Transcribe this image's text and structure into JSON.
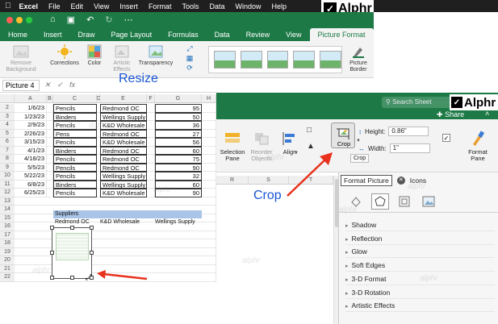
{
  "menubar": {
    "apple_icon": "apple-logo",
    "items": [
      "Excel",
      "File",
      "Edit",
      "View",
      "Insert",
      "Format",
      "Tools",
      "Data",
      "Window",
      "Help"
    ]
  },
  "branding": {
    "logo_text": "Alphr",
    "watermark": "alphr"
  },
  "ribbon_tabs": [
    "Home",
    "Insert",
    "Draw",
    "Page Layout",
    "Formulas",
    "Data",
    "Review",
    "View",
    "Picture Format"
  ],
  "active_tab": "Picture Format",
  "ribbon_left": {
    "remove_background": "Remove Background",
    "corrections": "Corrections",
    "color": "Color",
    "artistic_effects": "Artistic Effects",
    "transparency": "Transparency",
    "picture_border": "Picture Border"
  },
  "formula_bar": {
    "name_box": "Picture 4",
    "fx_symbol": "fx"
  },
  "annotations": {
    "resize": "Resize",
    "crop": "Crop"
  },
  "left_sheet": {
    "columns": [
      "A",
      "B",
      "C",
      "D",
      "E",
      "F",
      "G",
      "H"
    ],
    "rows": [
      {
        "num": "2",
        "date": "1/6/23",
        "item": "Pencils",
        "supplier": "Redmond OC",
        "qty": "95"
      },
      {
        "num": "3",
        "date": "1/23/23",
        "item": "Binders",
        "supplier": "Wellings Supply",
        "qty": "50"
      },
      {
        "num": "4",
        "date": "2/9/23",
        "item": "Pencils",
        "supplier": "K&D Wholesale",
        "qty": "36"
      },
      {
        "num": "5",
        "date": "2/26/23",
        "item": "Pens",
        "supplier": "Redmond OC",
        "qty": "27"
      },
      {
        "num": "6",
        "date": "3/15/23",
        "item": "Pencils",
        "supplier": "K&D Wholesale",
        "qty": "56"
      },
      {
        "num": "7",
        "date": "4/1/23",
        "item": "Binders",
        "supplier": "Redmond OC",
        "qty": "60"
      },
      {
        "num": "8",
        "date": "4/18/23",
        "item": "Pencils",
        "supplier": "Redmond OC",
        "qty": "75"
      },
      {
        "num": "9",
        "date": "5/5/23",
        "item": "Pencils",
        "supplier": "Redmond OC",
        "qty": "90"
      },
      {
        "num": "10",
        "date": "5/22/23",
        "item": "Pencils",
        "supplier": "Wellings Supply",
        "qty": "32"
      },
      {
        "num": "11",
        "date": "6/8/23",
        "item": "Binders",
        "supplier": "Wellings Supply",
        "qty": "60"
      },
      {
        "num": "12",
        "date": "6/25/23",
        "item": "Pencils",
        "supplier": "K&D Wholesale",
        "qty": "90"
      }
    ],
    "extra_rows": [
      "13",
      "14",
      "15",
      "16",
      "17",
      "18",
      "19",
      "20",
      "21",
      "22"
    ],
    "suppliers_header": "Suppliers",
    "suppliers": [
      "Redmond OC",
      "K&D Wholesale",
      "Wellings Supply"
    ]
  },
  "right_panel": {
    "search_placeholder": "Search Sheet",
    "share_label": "Share",
    "ribbon": {
      "selection_pane": "Selection Pane",
      "reorder_objects": "Reorder Objects",
      "align": "Align",
      "crop": "Crop",
      "height_label": "Height:",
      "height_value": "0.86\"",
      "width_label": "Width:",
      "width_value": "1\"",
      "format_pane": "Format Pane",
      "tooltip": "Crop"
    },
    "columns": [
      "R",
      "S",
      "T"
    ],
    "format_pane": {
      "tab_active": "Format Picture",
      "tab_other": "Icons",
      "sections": [
        "Shadow",
        "Reflection",
        "Glow",
        "Soft Edges",
        "3-D Format",
        "3-D Rotation",
        "Artistic Effects"
      ]
    }
  },
  "colors": {
    "excel_green": "#1d7a46",
    "annotation_blue": "#1a56d6",
    "arrow_red": "#e8321e"
  }
}
